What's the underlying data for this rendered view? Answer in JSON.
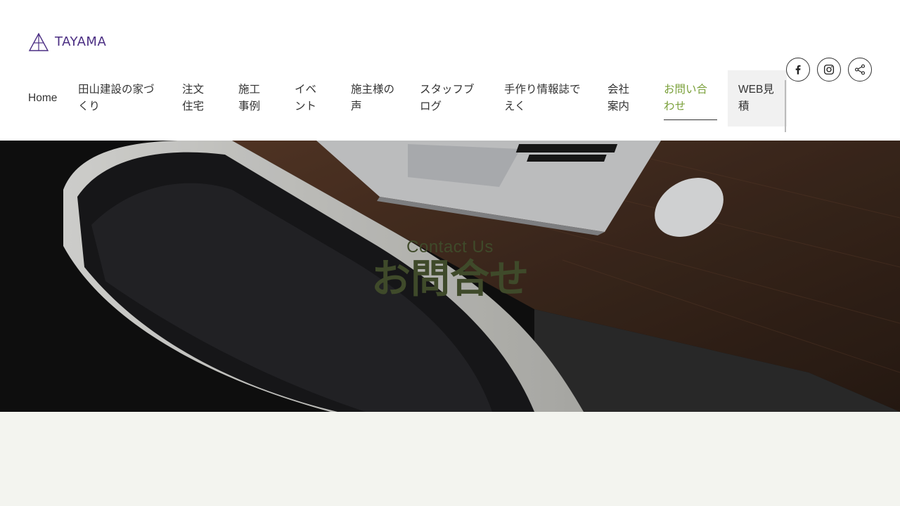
{
  "brand": {
    "name": "TAYAMA",
    "color": "#4b2e83",
    "icon": "triangle-logo-icon"
  },
  "nav": {
    "items": [
      {
        "label": "Home"
      },
      {
        "label": "田山建設の家づくり"
      },
      {
        "label": "注文住宅"
      },
      {
        "label": "施工事例"
      },
      {
        "label": "イベント"
      },
      {
        "label": "施主様の声"
      },
      {
        "label": "スタッフブログ"
      },
      {
        "label": "手作り情報誌でえく"
      },
      {
        "label": "会社案内"
      },
      {
        "label": "お問い合わせ",
        "active": true
      }
    ],
    "estimate_label": "WEB見積",
    "active_color": "#7aa03a"
  },
  "social": [
    {
      "icon": "facebook-icon"
    },
    {
      "icon": "instagram-icon"
    },
    {
      "icon": "share-icon"
    }
  ],
  "hero": {
    "subtitle": "Contact Us",
    "title": "お問合せ",
    "text_color": "#3f4a2a"
  },
  "page_bg": "#f3f4ef"
}
